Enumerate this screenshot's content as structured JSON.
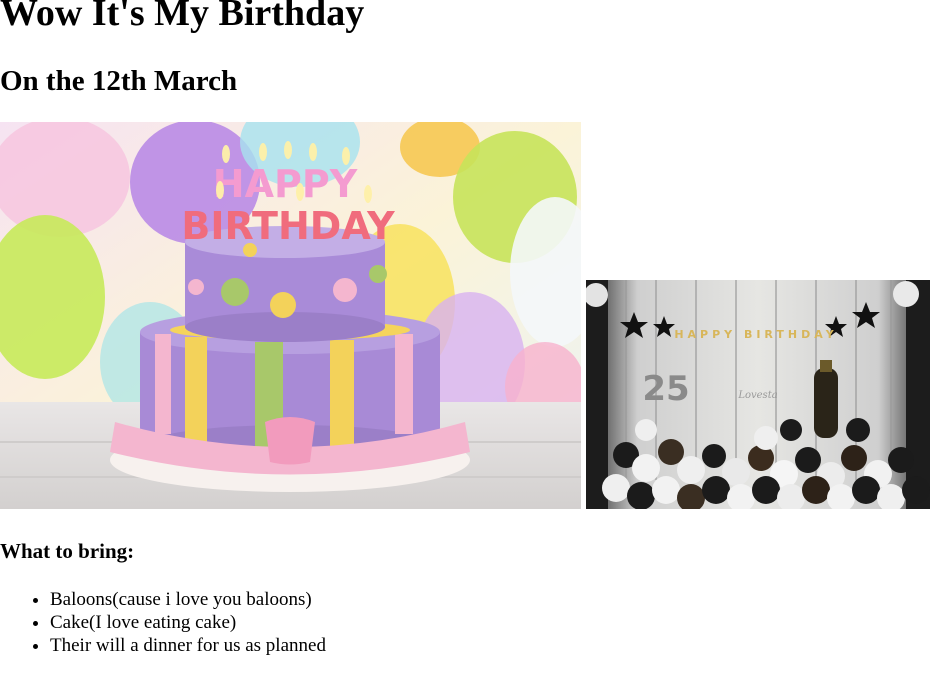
{
  "header": {
    "title": "Wow It's My Birthday",
    "subtitle": "On the 12th March"
  },
  "images": {
    "cake": {
      "caption_lines": [
        "HAPPY",
        "BIRTHDAY"
      ]
    },
    "decoration": {
      "banner_letters": "HAPPY BIRTHDAY",
      "number": "25",
      "watermark": "Lovesta"
    }
  },
  "bring": {
    "heading": "What to bring:",
    "items": [
      "Baloons(cause i love you baloons)",
      "Cake(I love eating cake)",
      "Their will a dinner for us as planned"
    ]
  },
  "colors": {
    "text": "#000000",
    "background": "#ffffff",
    "cake_purple": "#9b7fc8",
    "cake_pink": "#f4b6cf",
    "cake_yellow": "#f3d25a",
    "cake_green": "#a8c86a"
  }
}
